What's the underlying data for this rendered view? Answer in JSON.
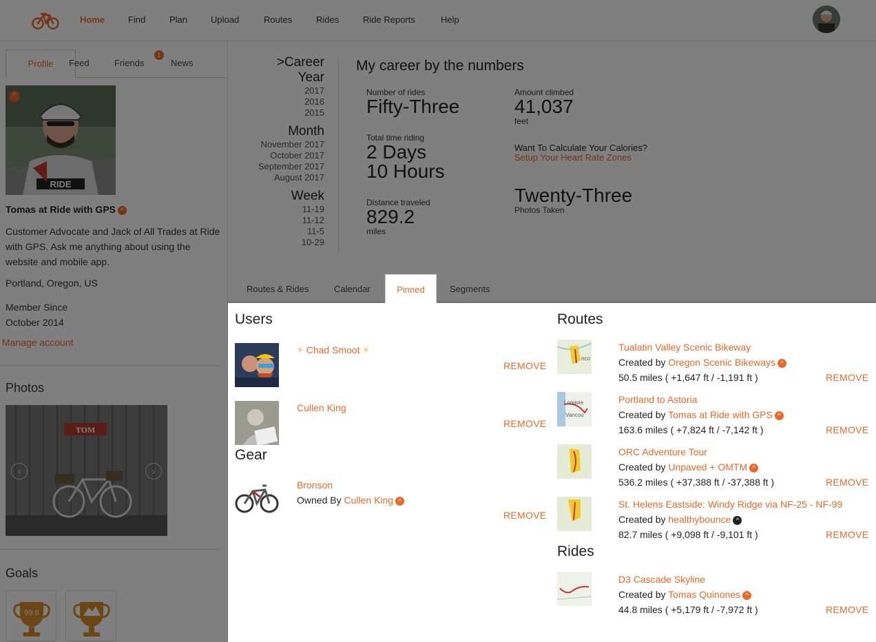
{
  "nav": {
    "items": [
      "Home",
      "Find",
      "Plan",
      "Upload",
      "Routes",
      "Rides",
      "Ride Reports",
      "Help"
    ],
    "active": "Home"
  },
  "left_tabs": {
    "profile": "Profile",
    "feed": "Feed",
    "friends": "Friends",
    "friends_badge": "1",
    "news": "News"
  },
  "profile": {
    "name": "Tomas at Ride with GPS",
    "bio": "Customer Advocate and Jack of All Trades at Ride with GPS. Ask me anything about using the website and mobile app.",
    "location": "Portland, Oregon, US",
    "member_since_label": "Member Since",
    "member_since": "October 2014",
    "manage_account": "Manage account"
  },
  "photos": {
    "title": "Photos",
    "sign_text": "TOM"
  },
  "goals": {
    "title": "Goals",
    "badge1": "99.8"
  },
  "career": {
    "heading_career": ">Career",
    "year_label": "Year",
    "years": [
      "2017",
      "2016",
      "2015"
    ],
    "month_label": "Month",
    "months": [
      "November 2017",
      "October 2017",
      "September 2017",
      "August 2017"
    ],
    "week_label": "Week",
    "weeks": [
      "11-19",
      "11-12",
      "11-5",
      "10-29"
    ],
    "title": "My career by the numbers",
    "rides_label": "Number of rides",
    "rides_value": "Fifty-Three",
    "time_label": "Total time riding",
    "time_value_1": "2 Days",
    "time_value_2": "10 Hours",
    "distance_label": "Distance traveled",
    "distance_value": "829.2",
    "distance_unit": "miles",
    "climbed_label": "Amount climbed",
    "climbed_value": "41,037",
    "climbed_unit": "feet",
    "calories_text": "Want To Calculate Your Calories?",
    "calories_link": "Setup Your Heart Rate Zones",
    "photos_value": "Twenty-Three",
    "photos_label": "Photos Taken"
  },
  "content_tabs": {
    "routes_rides": "Routes & Rides",
    "calendar": "Calendar",
    "pinned": "Pinned",
    "segments": "Segments"
  },
  "pinned": {
    "users_title": "Users",
    "users": [
      {
        "name": "Chad Smoot",
        "remove": "REMOVE"
      },
      {
        "name": "Cullen King",
        "remove": "REMOVE"
      }
    ],
    "gear_title": "Gear",
    "gear": {
      "name": "Bronson",
      "owned_by": "Owned By",
      "owner": "Cullen King",
      "remove": "REMOVE"
    },
    "routes_title": "Routes",
    "routes": [
      {
        "name": "Tualatin Valley Scenic Bikeway",
        "created_by": "Created by",
        "creator": "Oregon Scenic Bikeways",
        "stats": "50.5 miles ( +1,647 ft / -1,191 ft )",
        "remove": "REMOVE"
      },
      {
        "name": "Portland to Astoria",
        "created_by": "Created by",
        "creator": "Tomas at Ride with GPS",
        "stats": "163.6 miles ( +7,824 ft / -7,142 ft )",
        "remove": "REMOVE"
      },
      {
        "name": "ORC Adventure Tour",
        "created_by": "Created by",
        "creator": "Unpaved + OMTM",
        "stats": "536.2 miles ( +37,388 ft / -37,388 ft )",
        "remove": "REMOVE"
      },
      {
        "name": "St. Helens Eastside: Windy Ridge via NF-25 - NF-99",
        "created_by": "Created by",
        "creator": "healthybounce",
        "stats": "82.7 miles ( +9,098 ft / -9,101 ft )",
        "remove": "REMOVE"
      }
    ],
    "rides_title": "Rides",
    "rides": [
      {
        "name": "D3 Cascade Skyline",
        "created_by": "Created by",
        "creator": "Tomas Quinones",
        "stats": "44.8 miles ( +5,179 ft / -7,972 ft )",
        "remove": "REMOVE"
      }
    ]
  },
  "colors": {
    "accent": "#e8692a"
  }
}
